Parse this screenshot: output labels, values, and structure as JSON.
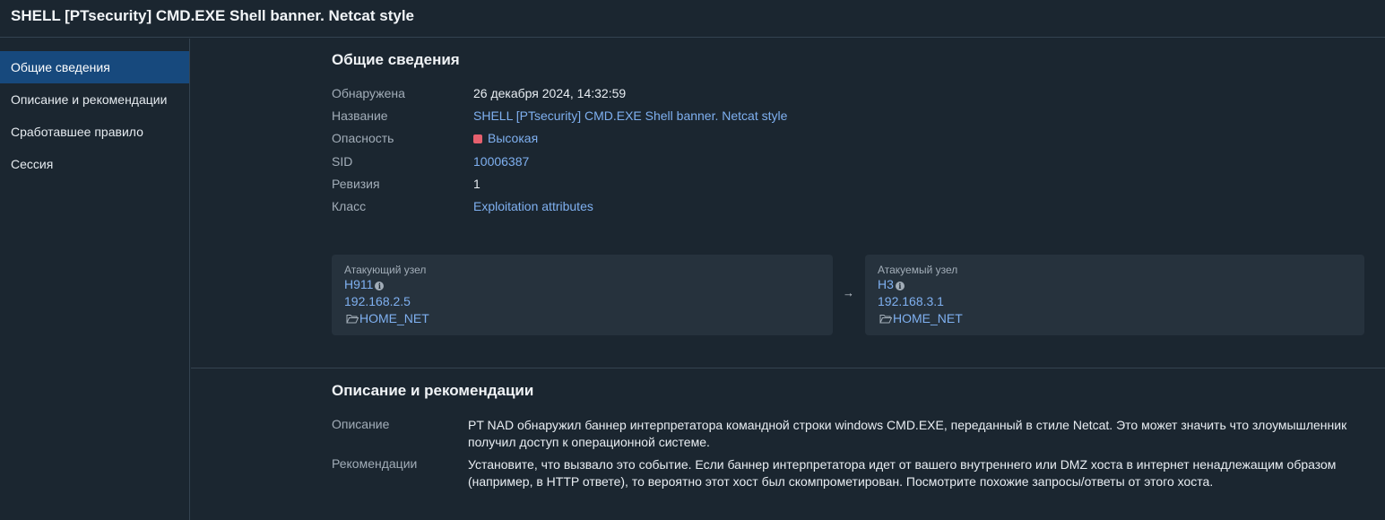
{
  "header": {
    "title": "SHELL [PTsecurity] CMD.EXE Shell banner. Netcat style"
  },
  "sidebar": {
    "items": [
      {
        "label": "Общие сведения",
        "active": true
      },
      {
        "label": "Описание и рекомендации",
        "active": false
      },
      {
        "label": "Сработавшее правило",
        "active": false
      },
      {
        "label": "Сессия",
        "active": false
      }
    ]
  },
  "general": {
    "title": "Общие сведения",
    "detected_label": "Обнаружена",
    "detected_value": "26 декабря 2024, 14:32:59",
    "name_label": "Название",
    "name_value": "SHELL [PTsecurity] CMD.EXE Shell banner. Netcat style",
    "severity_label": "Опасность",
    "severity_value": "Высокая",
    "severity_color": "#e6606e",
    "sid_label": "SID",
    "sid_value": "10006387",
    "revision_label": "Ревизия",
    "revision_value": "1",
    "class_label": "Класс",
    "class_value": "Exploitation attributes"
  },
  "attacker": {
    "label": "Атакующий узел",
    "name": "H911",
    "ip": "192.168.2.5",
    "network": "HOME_NET"
  },
  "target": {
    "label": "Атакуемый узел",
    "name": "H3",
    "ip": "192.168.3.1",
    "network": "HOME_NET"
  },
  "arrow": "→",
  "description": {
    "title": "Описание и рекомендации",
    "desc_label": "Описание",
    "desc_value": "PT NAD обнаружил баннер интерпретатора командной строки windows CMD.EXE, переданный в стиле Netcat. Это может значить что злоумышленник получил доступ к операционной системе.",
    "rec_label": "Рекомендации",
    "rec_value": "Установите, что вызвало это событие. Если баннер интерпретатора идет от вашего внутреннего или DMZ хоста в интернет ненадлежащим образом (например, в HTTP ответе), то вероятно этот хост был скомпрометирован. Посмотрите похожие запросы/ответы от этого хоста."
  },
  "colors": {
    "accent": "#17497d",
    "link": "#7fb0f0",
    "background": "#1b2630",
    "card": "#26323d"
  }
}
